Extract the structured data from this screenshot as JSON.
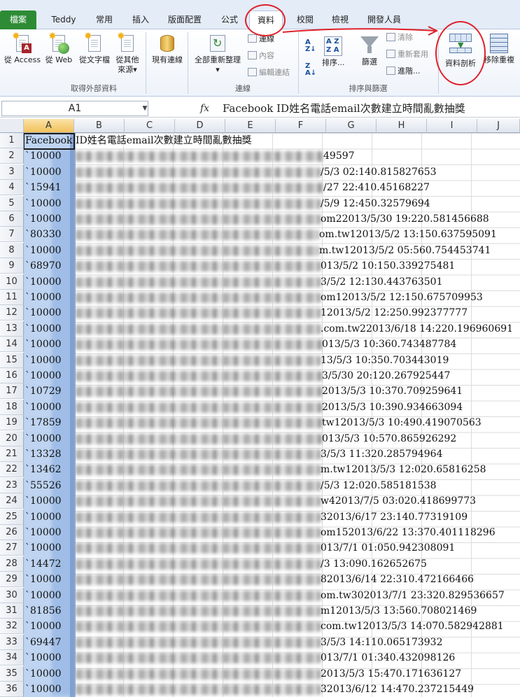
{
  "ribbon_tabs": [
    {
      "label": "檔案"
    },
    {
      "label": "Teddy"
    },
    {
      "label": "常用"
    },
    {
      "label": "插入"
    },
    {
      "label": "版面配置"
    },
    {
      "label": "公式"
    },
    {
      "label": "資料"
    },
    {
      "label": "校閱"
    },
    {
      "label": "檢視"
    },
    {
      "label": "開發人員"
    }
  ],
  "active_tab": "資料",
  "ribbon": {
    "get_external": {
      "group_label": "取得外部資料",
      "from_access": "從 Access",
      "from_web": "從 Web",
      "from_text": "從文字檔",
      "from_other": "從其他",
      "from_other_line2": "來源",
      "existing": "現有連線"
    },
    "connections": {
      "group_label": "連線",
      "refresh_all": "全部重新整理",
      "link": "連線",
      "properties": "內容",
      "edit_links": "編輯連結"
    },
    "sort_filter": {
      "group_label": "排序與篩選",
      "sort": "排序...",
      "filter": "篩選",
      "clear": "清除",
      "reapply": "重新套用",
      "advanced": "進階..."
    },
    "data_tools": {
      "text_to_columns": "資料剖析",
      "remove_duplicates": "移除重複"
    }
  },
  "formula_bar": {
    "name_box": "A1",
    "fx": "fx",
    "content": "Facebook ID姓名電話email次數建立時間亂數抽獎"
  },
  "columns": [
    "A",
    "B",
    "C",
    "D",
    "E",
    "F",
    "G",
    "H",
    "I",
    "J"
  ],
  "rows": [
    {
      "n": "1",
      "a": "Facebook ID姓名電話email次數建立時間亂數抽獎",
      "tail": ""
    },
    {
      "n": "2",
      "a": "`10000",
      "tail": "49597"
    },
    {
      "n": "3",
      "a": "`10000",
      "tail": "/5/3 02:140.815827653"
    },
    {
      "n": "4",
      "a": "`15941",
      "tail": "/27 22:410.45168227"
    },
    {
      "n": "5",
      "a": "`10000",
      "tail": "/5/9 12:450.32579694"
    },
    {
      "n": "6",
      "a": "`10000",
      "tail": "om22013/5/30 19:220.581456688"
    },
    {
      "n": "7",
      "a": "`80330",
      "tail": "om.tw12013/5/2 13:150.637595091"
    },
    {
      "n": "8",
      "a": "`10000",
      "tail": "m.tw12013/5/2 05:560.754453741"
    },
    {
      "n": "9",
      "a": "`68970",
      "tail": "013/5/2 10:150.339275481"
    },
    {
      "n": "10",
      "a": "`10000",
      "tail": "3/5/2 12:130.443763501"
    },
    {
      "n": "11",
      "a": "`10000",
      "tail": "om12013/5/2 12:150.675709953"
    },
    {
      "n": "12",
      "a": "`10000",
      "tail": "12013/5/2 12:250.992377777"
    },
    {
      "n": "13",
      "a": "`10000",
      "tail": ".com.tw22013/6/18 14:220.196960691"
    },
    {
      "n": "14",
      "a": "`10000",
      "tail": "013/5/3 10:360.743487784"
    },
    {
      "n": "15",
      "a": "`10000",
      "tail": "13/5/3 10:350.703443019"
    },
    {
      "n": "16",
      "a": "`10000",
      "tail": "3/5/30 20:120.267925447"
    },
    {
      "n": "17",
      "a": "`10729",
      "tail": "2013/5/3 10:370.709259641"
    },
    {
      "n": "18",
      "a": "`10000",
      "tail": "2013/5/3 10:390.934663094"
    },
    {
      "n": "19",
      "a": "`17859",
      "tail": "tw12013/5/3 10:490.419070563"
    },
    {
      "n": "20",
      "a": "`10000",
      "tail": "013/5/3 10:570.865926292"
    },
    {
      "n": "21",
      "a": "`13328",
      "tail": "3/5/3 11:320.285794964"
    },
    {
      "n": "22",
      "a": "`13462",
      "tail": "m.tw12013/5/3 12:020.65816258"
    },
    {
      "n": "23",
      "a": "`55526",
      "tail": "/5/3 12:020.585181538"
    },
    {
      "n": "24",
      "a": "`10000",
      "tail": "w42013/7/5 03:020.418699773"
    },
    {
      "n": "25",
      "a": "`10000",
      "tail": "32013/6/17 23:140.77319109"
    },
    {
      "n": "26",
      "a": "`10000",
      "tail": "om152013/6/22 13:370.401118296"
    },
    {
      "n": "27",
      "a": "`10000",
      "tail": "013/7/1 01:050.942308091"
    },
    {
      "n": "28",
      "a": "`14472",
      "tail": "/3 13:090.162652675"
    },
    {
      "n": "29",
      "a": "`10000",
      "tail": "82013/6/14 22:310.472166466"
    },
    {
      "n": "30",
      "a": "`10000",
      "tail": "om.tw302013/7/1 23:320.829536657"
    },
    {
      "n": "31",
      "a": "`81856",
      "tail": "m12013/5/3 13:560.708021469"
    },
    {
      "n": "32",
      "a": "`10000",
      "tail": "com.tw12013/5/3 14:070.582942881"
    },
    {
      "n": "33",
      "a": "`69447",
      "tail": "3/5/3 14:110.065173932"
    },
    {
      "n": "34",
      "a": "`10000",
      "tail": "013/7/1 01:340.432098126"
    },
    {
      "n": "35",
      "a": "`10000",
      "tail": "2013/5/3 15:470.171636127"
    },
    {
      "n": "36",
      "a": "`10000",
      "tail": "32013/6/12 14:470.237215449"
    }
  ]
}
